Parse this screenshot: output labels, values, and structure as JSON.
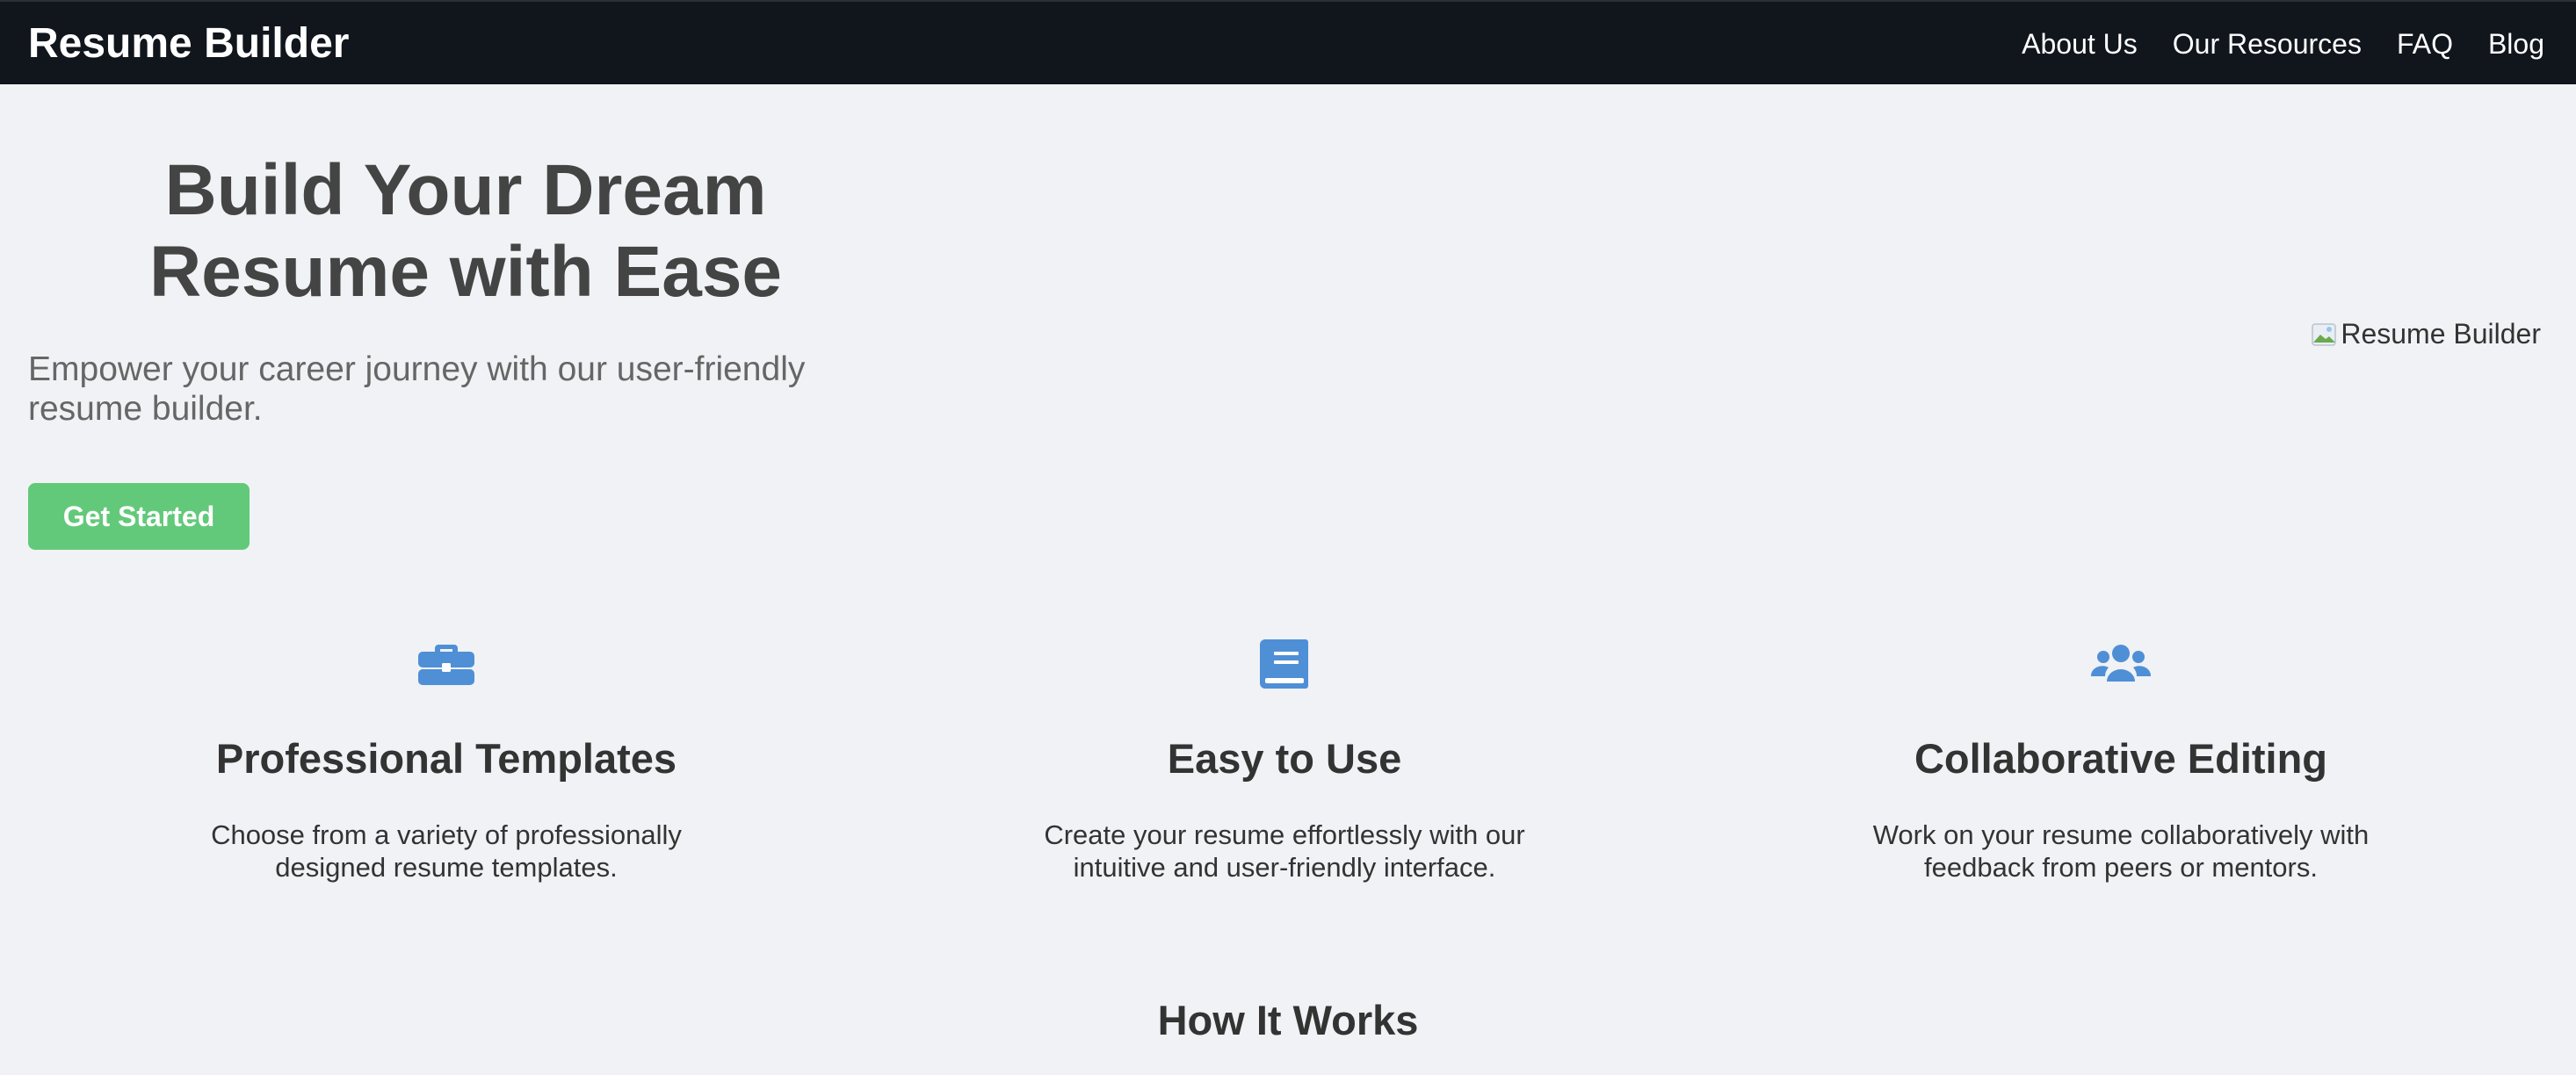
{
  "header": {
    "brand": "Resume Builder",
    "nav": [
      "About Us",
      "Our Resources",
      "FAQ",
      "Blog"
    ]
  },
  "hero": {
    "title_line1": "Build Your Dream",
    "title_line2": "Resume with Ease",
    "subtitle_line1": "Empower your career journey with our user-friendly",
    "subtitle_line2": "resume builder.",
    "cta_label": "Get Started",
    "image_alt": "Resume Builder"
  },
  "features": [
    {
      "icon": "briefcase-icon",
      "title": "Professional Templates",
      "desc_line1": "Choose from a variety of professionally",
      "desc_line2": "designed resume templates."
    },
    {
      "icon": "book-icon",
      "title": "Easy to Use",
      "desc_line1": "Create your resume effortlessly with our",
      "desc_line2": "intuitive and user-friendly interface."
    },
    {
      "icon": "users-icon",
      "title": "Collaborative Editing",
      "desc_line1": "Work on your resume collaboratively with",
      "desc_line2": "feedback from peers or mentors."
    }
  ],
  "how_it_works": {
    "title": "How It Works"
  },
  "colors": {
    "header_bg": "#11151c",
    "page_bg": "#f0f2f5",
    "cta_bg": "#63c97a",
    "icon_blue": "#4f8fd6"
  }
}
